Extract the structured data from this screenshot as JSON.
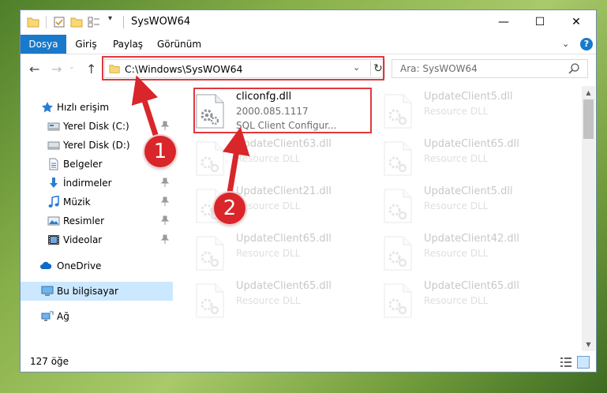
{
  "window": {
    "title": "SysWOW64",
    "minimize_glyph": "—",
    "maximize_glyph": "☐",
    "close_glyph": "✕",
    "quick_access_dropdown": "▾"
  },
  "ribbon": {
    "tabs": [
      "Dosya",
      "Giriş",
      "Paylaş",
      "Görünüm"
    ],
    "expand_glyph": "⌄",
    "help_label": "?"
  },
  "navigation": {
    "back_glyph": "←",
    "forward_glyph": "→",
    "history_glyph": "⌄",
    "up_glyph": "↑",
    "address_path": "C:\\Windows\\SysWOW64",
    "address_dropdown": "⌄",
    "refresh_glyph": "↻",
    "search_placeholder": "Ara: SysWOW64"
  },
  "nav_pane": {
    "items": [
      {
        "label": "Hızlı erişim",
        "icon": "star-icon",
        "pinned": false
      },
      {
        "label": "Yerel Disk (C:)",
        "icon": "drive-icon",
        "pinned": true
      },
      {
        "label": "Yerel Disk (D:)",
        "icon": "drive-icon",
        "pinned": true
      },
      {
        "label": "Belgeler",
        "icon": "documents-icon",
        "pinned": true
      },
      {
        "label": "İndirmeler",
        "icon": "download-icon",
        "pinned": true
      },
      {
        "label": "Müzik",
        "icon": "music-icon",
        "pinned": true
      },
      {
        "label": "Resimler",
        "icon": "pictures-icon",
        "pinned": true
      },
      {
        "label": "Videolar",
        "icon": "video-icon",
        "pinned": true
      },
      {
        "label": "OneDrive",
        "icon": "cloud-icon",
        "pinned": false
      },
      {
        "label": "Bu bilgisayar",
        "icon": "computer-icon",
        "pinned": false,
        "selected": true
      },
      {
        "label": "Ağ",
        "icon": "network-icon",
        "pinned": false
      }
    ]
  },
  "files": [
    {
      "name": "cliconfg.dll",
      "line2": "2000.085.1117",
      "line3": "SQL Client Configur...",
      "highlighted": true
    },
    {
      "name": "UpdateClient5.dll",
      "line2": "Resource DLL",
      "highlighted": false
    },
    {
      "name": "UpdateClient63.dll",
      "line2": "Resource DLL",
      "highlighted": false
    },
    {
      "name": "UpdateClient65.dll",
      "line2": "Resource DLL",
      "highlighted": false
    },
    {
      "name": "UpdateClient21.dll",
      "line2": "Resource DLL",
      "highlighted": false
    },
    {
      "name": "UpdateClient5.dll",
      "line2": "Resource DLL",
      "highlighted": false
    },
    {
      "name": "UpdateClient65.dll",
      "line2": "Resource DLL",
      "highlighted": false
    },
    {
      "name": "UpdateClient42.dll",
      "line2": "Resource DLL",
      "highlighted": false
    },
    {
      "name": "UpdateClient65.dll",
      "line2": "Resource DLL",
      "highlighted": false
    },
    {
      "name": "UpdateClient65.dll",
      "line2": "Resource DLL",
      "highlighted": false
    }
  ],
  "status": {
    "item_count": "127 öğe"
  },
  "annotations": {
    "step1": "1",
    "step2": "2",
    "color": "#e0383e"
  },
  "colors": {
    "accent": "#1979ca",
    "selection": "#cce8ff",
    "annotation_red": "#d8262b"
  }
}
